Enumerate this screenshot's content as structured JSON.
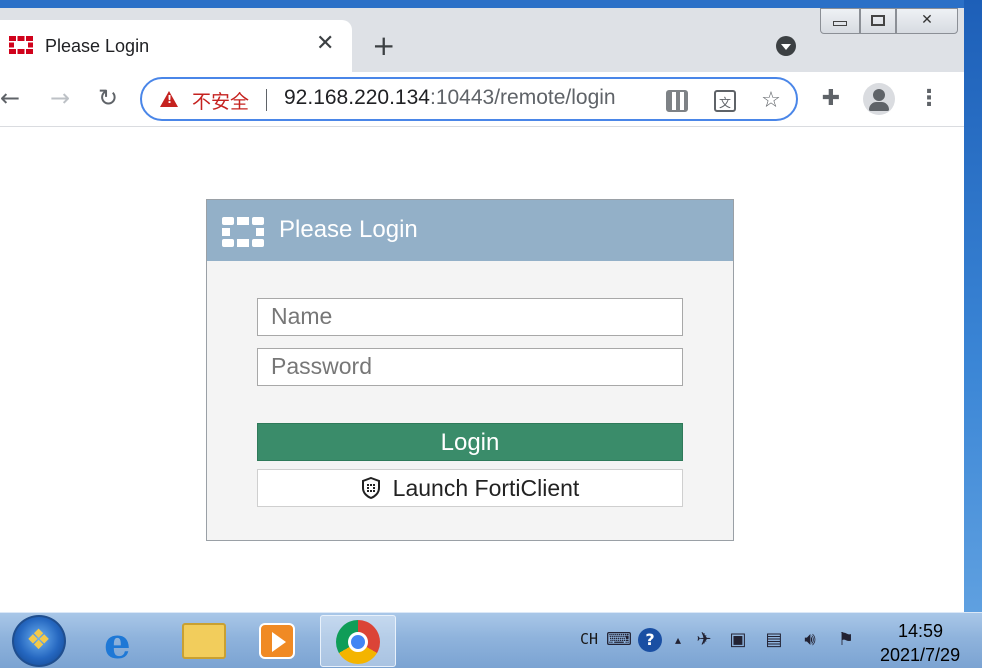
{
  "browser": {
    "tab": {
      "title": "Please Login",
      "close": "✕"
    },
    "new_tab": "+",
    "address": {
      "warning": "不安全",
      "host": "92.168.220.134",
      "rest": ":10443/remote/login"
    }
  },
  "login": {
    "title": "Please Login",
    "name_placeholder": "Name",
    "password_placeholder": "Password",
    "login_button": "Login",
    "forticlient_button": "Launch FortiClient",
    "colors": {
      "header": "#93b0c8",
      "login_button": "#3a8c6a"
    }
  },
  "taskbar": {
    "lang": "CH",
    "time": "14:59",
    "date": "2021/7/29"
  }
}
